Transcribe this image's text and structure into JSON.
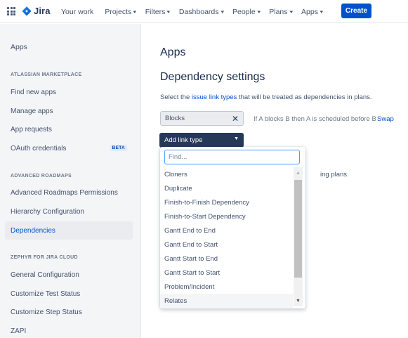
{
  "topnav": {
    "logo_text": "Jira",
    "items": [
      {
        "label": "Your work",
        "has_chevron": false
      },
      {
        "label": "Projects",
        "has_chevron": true
      },
      {
        "label": "Filters",
        "has_chevron": true
      },
      {
        "label": "Dashboards",
        "has_chevron": true
      },
      {
        "label": "People",
        "has_chevron": true
      },
      {
        "label": "Plans",
        "has_chevron": true
      },
      {
        "label": "Apps",
        "has_chevron": true
      }
    ],
    "create_label": "Create",
    "accent": "#0052cc"
  },
  "sidebar": {
    "title": "Apps",
    "sections": [
      {
        "heading": "ATLASSIAN MARKETPLACE",
        "items": [
          {
            "label": "Find new apps"
          },
          {
            "label": "Manage apps"
          },
          {
            "label": "App requests"
          },
          {
            "label": "OAuth credentials",
            "badge": "BETA"
          }
        ]
      },
      {
        "heading": "ADVANCED ROADMAPS",
        "items": [
          {
            "label": "Advanced Roadmaps Permissions"
          },
          {
            "label": "Hierarchy Configuration"
          },
          {
            "label": "Dependencies",
            "active": true
          }
        ]
      },
      {
        "heading": "ZEPHYR FOR JIRA CLOUD",
        "items": [
          {
            "label": "General Configuration"
          },
          {
            "label": "Customize Test Status"
          },
          {
            "label": "Customize Step Status"
          },
          {
            "label": "ZAPI"
          }
        ]
      }
    ]
  },
  "main": {
    "page_title": "Apps",
    "section_title": "Dependency settings",
    "desc_prefix": "Select the ",
    "desc_link": "issue link types",
    "desc_suffix": " that will be treated as dependencies in plans.",
    "tag_label": "Blocks",
    "hint": "If A blocks B then A is scheduled before B",
    "swap_label": "Swap",
    "add_link_label": "Add link type",
    "partial_text": "ing plans."
  },
  "dropdown": {
    "find_placeholder": "Find...",
    "find_value": "",
    "options": [
      "Cloners",
      "Duplicate",
      "Finish-to-Finish Dependency",
      "Finish-to-Start Dependency",
      "Gantt End to End",
      "Gantt End to Start",
      "Gantt Start to End",
      "Gantt Start to Start",
      "Problem/Incident",
      "Relates"
    ],
    "highlighted_option": "Relates"
  }
}
